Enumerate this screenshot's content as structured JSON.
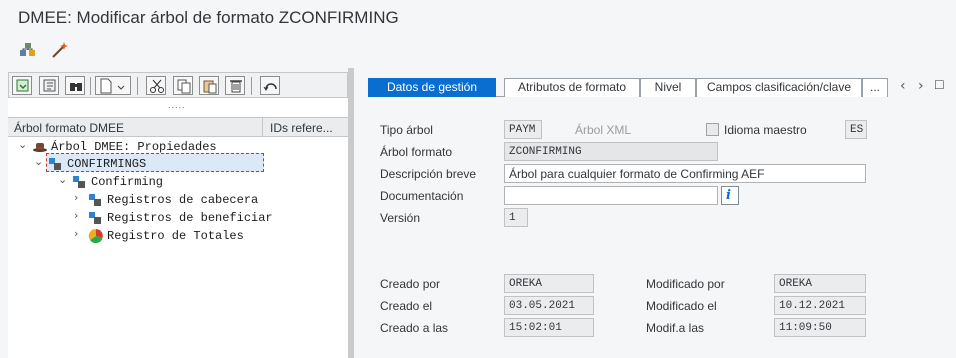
{
  "window": {
    "title": "DMEE: Modificar árbol de formato ZCONFIRMING"
  },
  "app_toolbar": {
    "items": [
      "hierarchy-change-icon",
      "magic-wand-icon"
    ]
  },
  "left_toolbar": {
    "grip": "....."
  },
  "tree": {
    "columns": [
      "Árbol formato DMEE",
      "IDs refere..."
    ],
    "nodes": [
      {
        "label": "Árbol DMEE: Propiedades",
        "icon": "hat-icon"
      },
      {
        "label": "CONFIRMINGS",
        "icon": "structure-icon"
      },
      {
        "label": "Confirming",
        "icon": "segment-icon"
      },
      {
        "label": "Registros de cabecera",
        "icon": "segment-icon"
      },
      {
        "label": "Registros de beneficiar",
        "icon": "segment-icon"
      },
      {
        "label": "Registro de Totales",
        "icon": "atom-icon"
      }
    ]
  },
  "tabs": [
    "Datos de gestión",
    "Atributos de formato",
    "Nivel",
    "Campos clasificación/clave",
    "..."
  ],
  "tab_nav": {
    "prev": "‹",
    "next": "›",
    "list": "☐"
  },
  "form": {
    "tipo_arbol": {
      "label": "Tipo árbol",
      "value": "PAYM"
    },
    "arbol_xml": {
      "label": "Árbol XML"
    },
    "idioma_maestro": {
      "label": "Idioma maestro",
      "value": "ES"
    },
    "arbol_formato": {
      "label": "Árbol formato",
      "value": "ZCONFIRMING"
    },
    "descripcion": {
      "label": "Descripción breve",
      "value": "Árbol para cualquier formato de Confirming AEF"
    },
    "documentacion": {
      "label": "Documentación",
      "value": "",
      "info": "i"
    },
    "version": {
      "label": "Versión",
      "value": "1"
    },
    "creado_por": {
      "label": "Creado por",
      "value": "OREKA"
    },
    "creado_el": {
      "label": "Creado el",
      "value": "03.05.2021"
    },
    "creado_a_las": {
      "label": "Creado a las",
      "value": "15:02:01"
    },
    "modificado_por": {
      "label": "Modificado por",
      "value": "OREKA"
    },
    "modificado_el": {
      "label": "Modificado el",
      "value": "10.12.2021"
    },
    "modif_a_las": {
      "label": "Modif.a las",
      "value": "11:09:50"
    }
  },
  "colors": {
    "accent": "#0a6ed1",
    "selection": "#dbe9f7",
    "background": "#f5f6f7"
  }
}
